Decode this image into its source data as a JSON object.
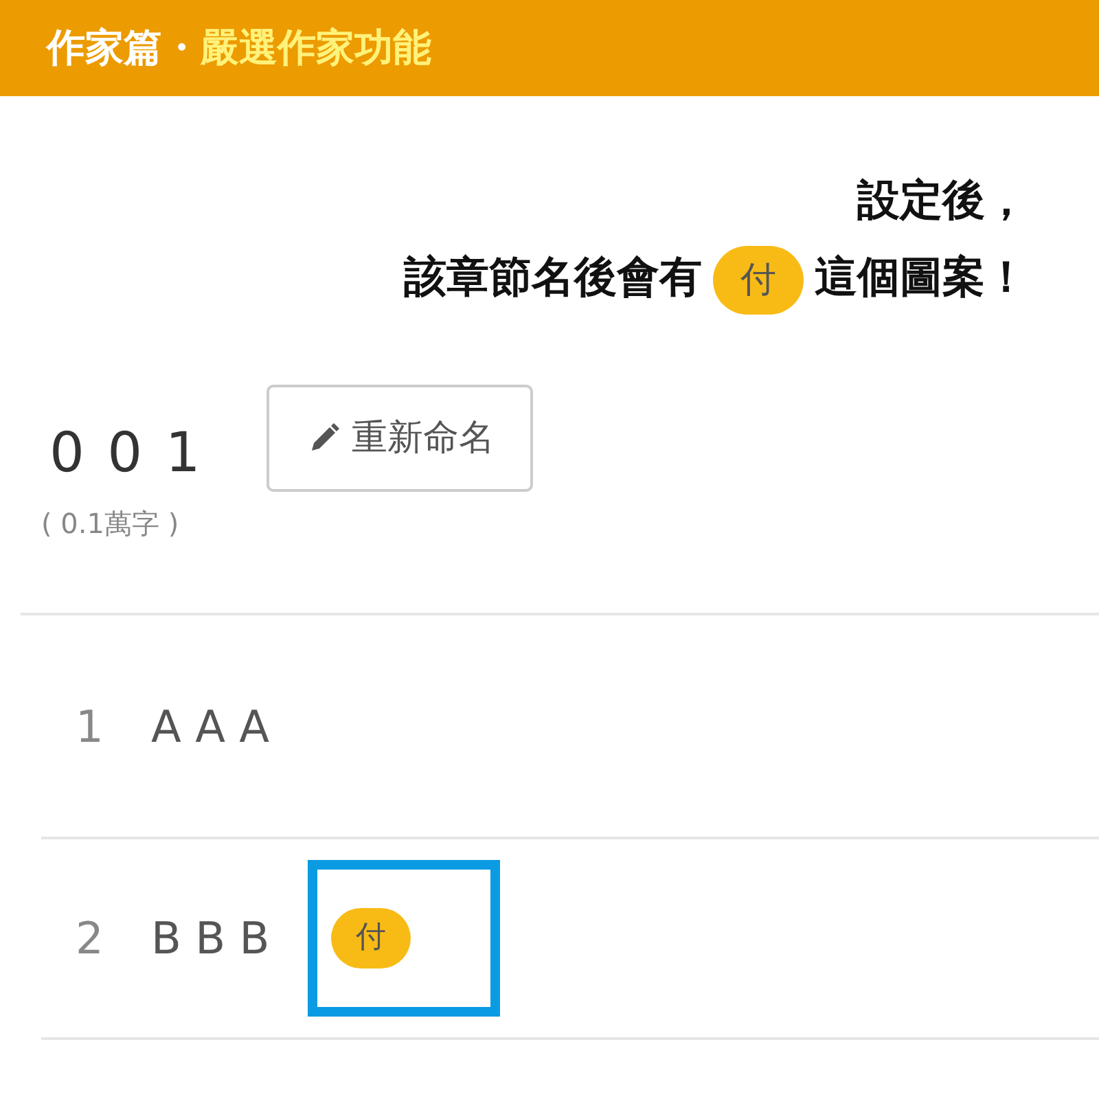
{
  "header": {
    "section": "作家篇・",
    "topic": "嚴選作家功能"
  },
  "callout": {
    "line_1": "設定後，",
    "line_2_before": "該章節名後會有",
    "badge": "付",
    "line_2_after": "這個圖案！"
  },
  "volume": {
    "number": "0 0 1",
    "word_count": "( 0.1萬字 )",
    "rename_button": "重新命名"
  },
  "chapters": [
    {
      "index": "1",
      "title": "A A A",
      "highlighted": false
    },
    {
      "index": "2",
      "title": "B B B",
      "badge": "付",
      "highlighted": true
    }
  ]
}
